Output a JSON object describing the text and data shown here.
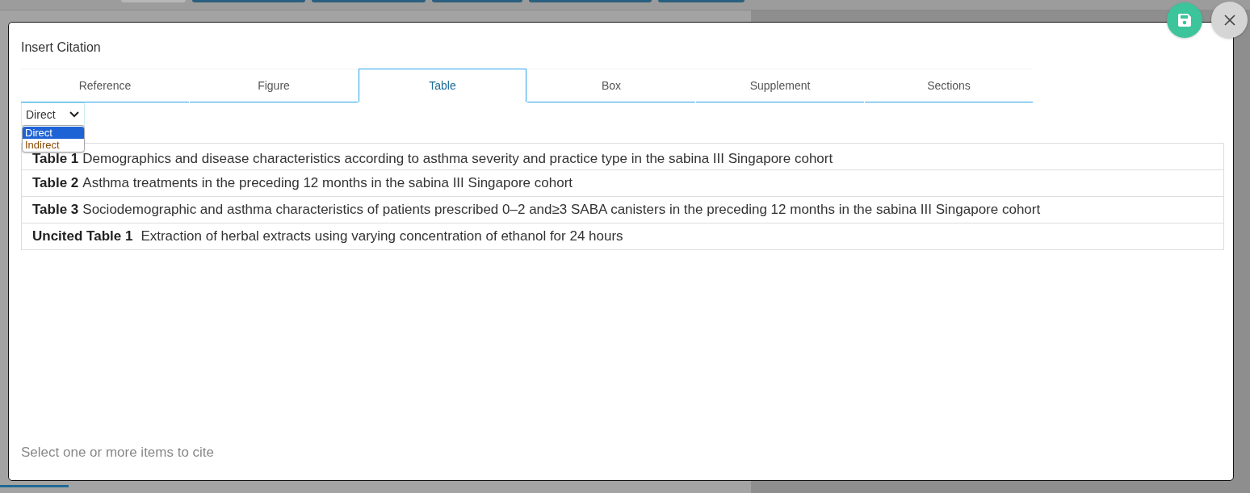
{
  "dialog": {
    "title": "Insert Citation",
    "tabs": [
      {
        "label": "Reference",
        "selected": false
      },
      {
        "label": "Figure",
        "selected": false
      },
      {
        "label": "Table",
        "selected": true
      },
      {
        "label": "Box",
        "selected": false
      },
      {
        "label": "Supplement",
        "selected": false
      },
      {
        "label": "Sections",
        "selected": false
      }
    ],
    "citation_type": {
      "value": "Direct",
      "expanded": true,
      "options": [
        {
          "label": "Direct",
          "selected": true
        },
        {
          "label": "Indirect",
          "selected": false
        }
      ]
    },
    "items": [
      {
        "label": "Table 1",
        "caption": "Demographics and disease characteristics according to asthma severity and practice type in the sabina III Singapore cohort"
      },
      {
        "label": "Table 2",
        "caption": "Asthma treatments in the preceding 12 months in the sabina III Singapore cohort"
      },
      {
        "label": "Table 3",
        "caption": "Sociodemographic and asthma characteristics of patients prescribed 0–2 and≥3 SABA canisters in the preceding 12 months in the sabina III Singapore cohort"
      },
      {
        "label": "Uncited Table 1",
        "caption": "Extraction of herbal extracts using varying concentration of ethanol for 24 hours"
      }
    ],
    "hint": "Select one or more items to cite"
  }
}
